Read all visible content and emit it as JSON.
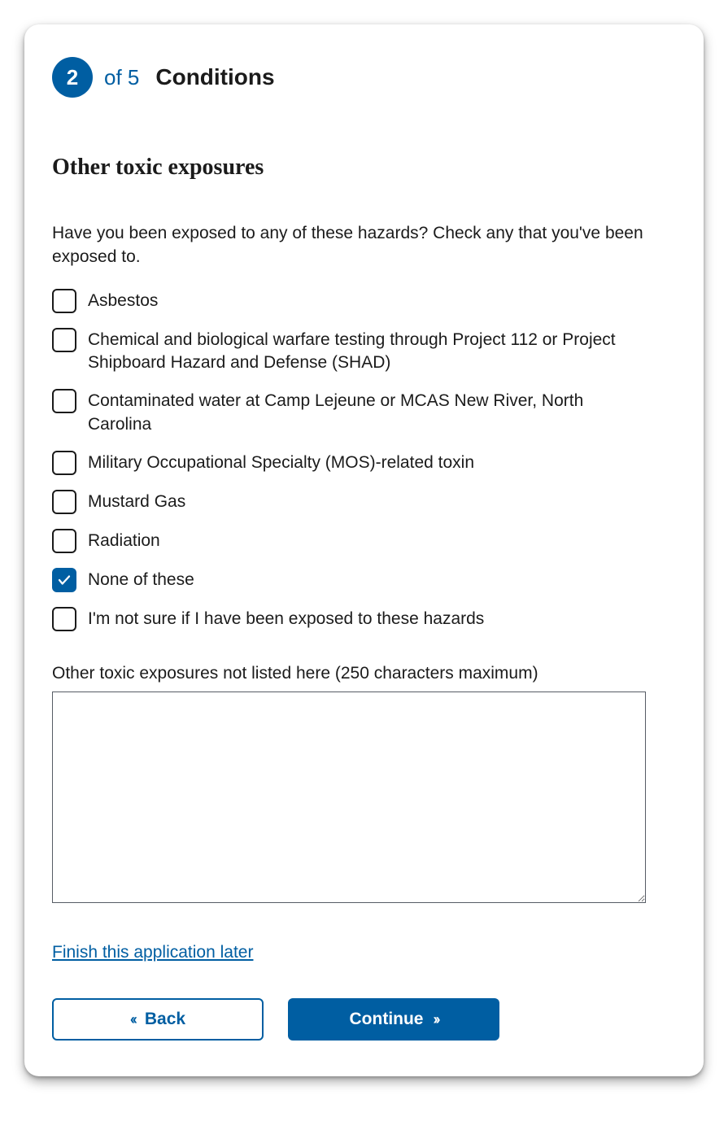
{
  "step": {
    "current": "2",
    "of_text": "of 5",
    "title": "Conditions"
  },
  "section_heading": "Other toxic exposures",
  "question": "Have you been exposed to any of these hazards? Check any that you've been exposed to.",
  "options": [
    {
      "label": "Asbestos",
      "checked": false
    },
    {
      "label": "Chemical and biological warfare testing through Project 112 or Project Shipboard Hazard and Defense (SHAD)",
      "checked": false
    },
    {
      "label": "Contaminated water at Camp Lejeune or MCAS New River, North Carolina",
      "checked": false
    },
    {
      "label": "Military Occupational Specialty (MOS)-related toxin",
      "checked": false
    },
    {
      "label": "Mustard Gas",
      "checked": false
    },
    {
      "label": "Radiation",
      "checked": false
    },
    {
      "label": "None of these",
      "checked": true
    },
    {
      "label": "I'm not sure if I have been exposed to these hazards",
      "checked": false
    }
  ],
  "other_label": "Other toxic exposures not listed here (250 characters maximum)",
  "other_value": "",
  "finish_link": "Finish this application later",
  "buttons": {
    "back": "Back",
    "continue": "Continue"
  }
}
